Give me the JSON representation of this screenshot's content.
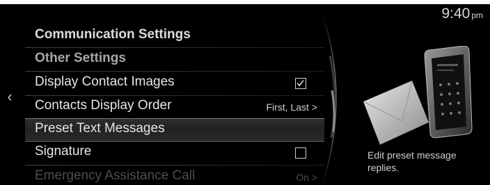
{
  "status_bar": {
    "time": "9:40",
    "ampm": "pm"
  },
  "menu": {
    "header": "Communication Settings",
    "subheader": "Other Settings",
    "items": [
      {
        "label": "Display Contact Images",
        "control": "checkbox",
        "checked": true
      },
      {
        "label": "Contacts Display Order",
        "value": "First, Last >"
      },
      {
        "label": "Preset Text Messages",
        "selected": true
      },
      {
        "label": "Signature",
        "control": "checkbox",
        "checked": false
      },
      {
        "label": "Emergency Assistance Call",
        "value": "On >"
      }
    ]
  },
  "help": {
    "text": "Edit preset message replies."
  }
}
